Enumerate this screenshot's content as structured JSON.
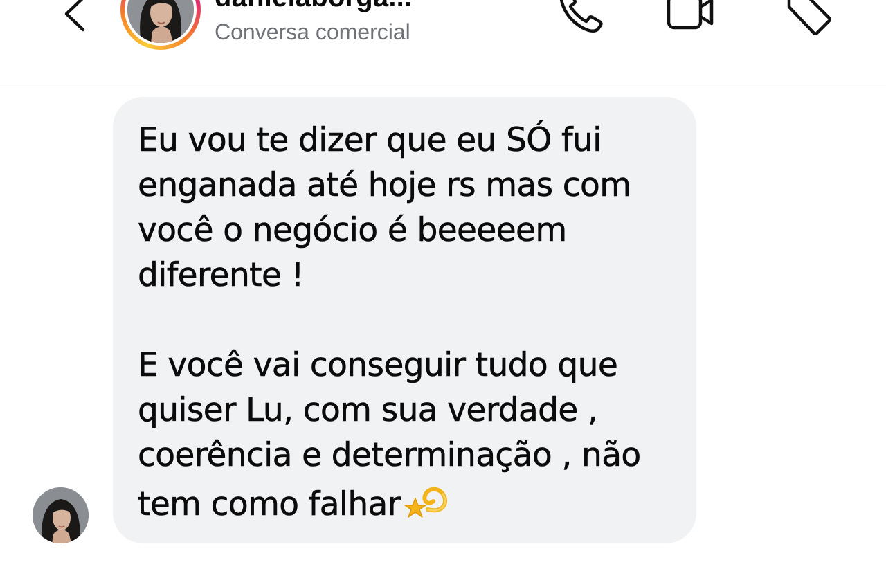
{
  "header": {
    "username": "danielaborga...",
    "subtitle": "Conversa comercial",
    "icons": {
      "back": "chevron-left-icon",
      "call": "phone-icon",
      "video": "video-camera-icon",
      "tag": "tag-icon"
    },
    "story_ring_colors": [
      "#fdcb36",
      "#f58529",
      "#e1306c",
      "#c13584"
    ]
  },
  "message": {
    "paragraph_1": "Eu vou te dizer que eu SÓ fui enganada até hoje rs mas com você o negócio é beeeeem diferente !",
    "paragraph_2": "E você vai conseguir tudo que quiser Lu, com sua verdade , coerência e determinação , não tem como falhar",
    "emoji": "dizzy-star-emoji",
    "bubble_color": "#f1f2f4"
  }
}
